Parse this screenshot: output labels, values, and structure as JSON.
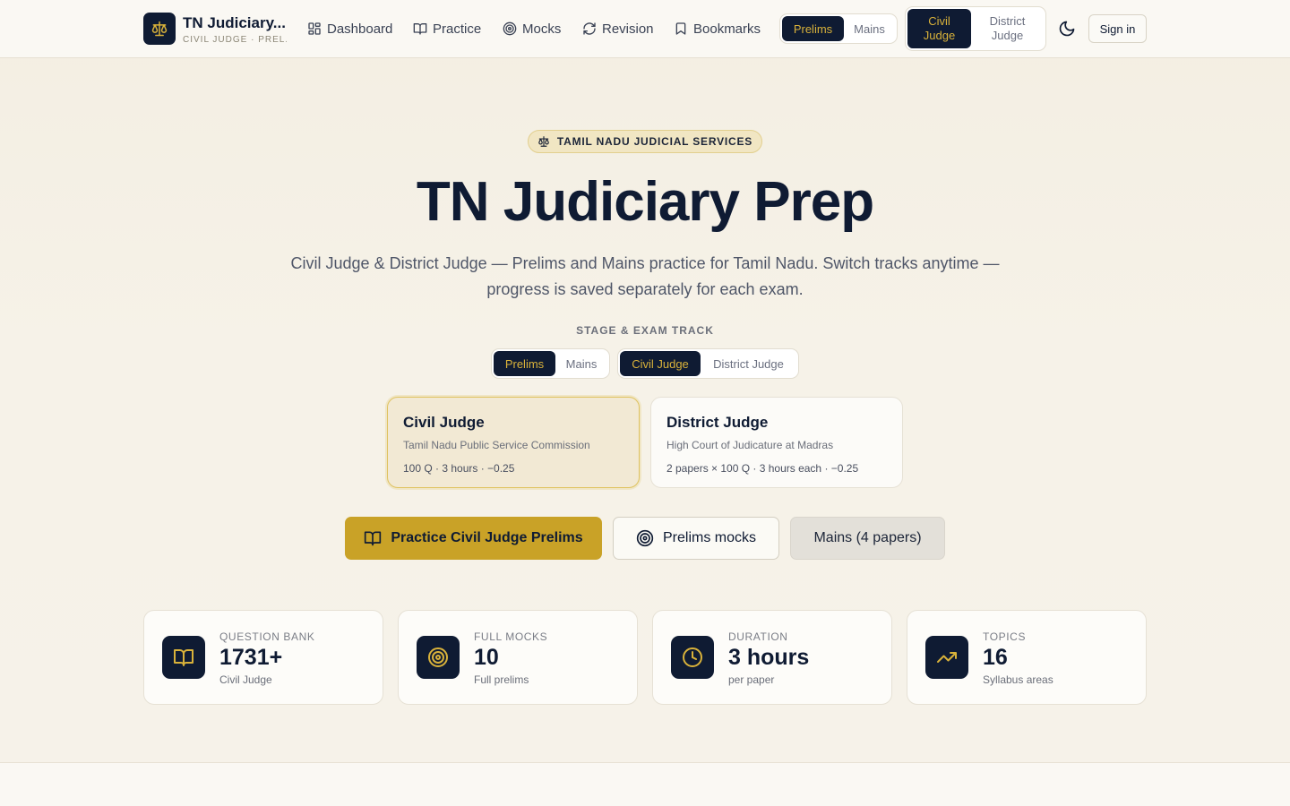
{
  "header": {
    "brand_title": "TN Judiciary...",
    "brand_sub": "CIVIL JUDGE · PREL...",
    "nav": [
      {
        "label": "Dashboard",
        "icon": "dashboard-icon"
      },
      {
        "label": "Practice",
        "icon": "book-icon"
      },
      {
        "label": "Mocks",
        "icon": "target-icon"
      },
      {
        "label": "Revision",
        "icon": "refresh-icon"
      },
      {
        "label": "Bookmarks",
        "icon": "bookmark-icon"
      }
    ],
    "stage_toggle": {
      "options": [
        "Prelims",
        "Mains"
      ],
      "selected": "Prelims"
    },
    "exam_toggle": {
      "options": [
        "Civil Judge",
        "District Judge"
      ],
      "selected": "Civil Judge"
    },
    "theme_icon": "moon-icon",
    "signin_label": "Sign in"
  },
  "hero": {
    "badge": "TAMIL NADU JUDICIAL SERVICES",
    "title": "TN Judiciary Prep",
    "description": "Civil Judge & District Judge — Prelims and Mains practice for Tamil Nadu. Switch tracks anytime — progress is saved separately for each exam.",
    "track_label": "STAGE & EXAM TRACK",
    "stage_toggle": {
      "options": [
        "Prelims",
        "Mains"
      ],
      "selected": "Prelims"
    },
    "exam_toggle": {
      "options": [
        "Civil Judge",
        "District Judge"
      ],
      "selected": "Civil Judge"
    }
  },
  "exam_cards": [
    {
      "title": "Civil Judge",
      "body": "Tamil Nadu Public Service Commission",
      "meta": "100 Q · 3 hours · −0.25",
      "selected": true
    },
    {
      "title": "District Judge",
      "body": "High Court of Judicature at Madras",
      "meta": "2 papers × 100 Q · 3 hours each · −0.25",
      "selected": false
    }
  ],
  "actions": {
    "primary": "Practice Civil Judge Prelims",
    "mocks": "Prelims mocks",
    "mains": "Mains (4 papers)"
  },
  "stats": [
    {
      "label": "QUESTION BANK",
      "value": "1731+",
      "sub": "Civil Judge",
      "icon": "book-icon"
    },
    {
      "label": "FULL MOCKS",
      "value": "10",
      "sub": "Full prelims",
      "icon": "target-icon"
    },
    {
      "label": "DURATION",
      "value": "3 hours",
      "sub": "per paper",
      "icon": "clock-icon"
    },
    {
      "label": "TOPICS",
      "value": "16",
      "sub": "Syllabus areas",
      "icon": "trending-up-icon"
    }
  ],
  "colors": {
    "navy": "#0f1b33",
    "gold": "#c9a227",
    "gold_text": "#d9b23a",
    "cream": "#f4efe3"
  }
}
